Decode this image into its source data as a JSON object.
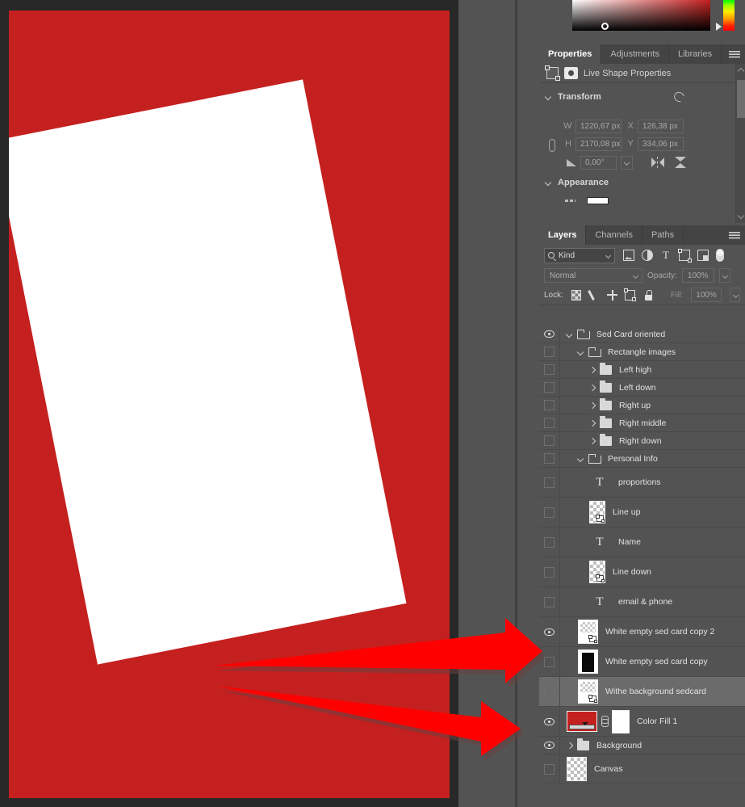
{
  "colors": {
    "canvas_fill": "#c4201f",
    "card": "#ffffff",
    "panel_bg": "#535353",
    "panel_tab_bg": "#444444",
    "selected_row": "#6b6b6b",
    "annotation_arrow": "#ff0000"
  },
  "color_picker": {
    "name": "color-picker-strip",
    "hue_label": "hue-slider",
    "sv_label": "saturation-value-field"
  },
  "properties_panel": {
    "tabs": [
      {
        "label": "Properties",
        "active": true
      },
      {
        "label": "Adjustments",
        "active": false
      },
      {
        "label": "Libraries",
        "active": false
      }
    ],
    "header_label": "Live Shape Properties",
    "sections": {
      "transform": {
        "title": "Transform",
        "fields": [
          {
            "label": "W",
            "value": "1220,67 px"
          },
          {
            "label": "X",
            "value": "126,38 px"
          },
          {
            "label": "H",
            "value": "2170,08 px"
          },
          {
            "label": "Y",
            "value": "334,06 px"
          }
        ],
        "angle": {
          "label": "angle",
          "value": "0,00°"
        }
      },
      "appearance": {
        "title": "Appearance"
      }
    }
  },
  "layers_panel": {
    "tabs": [
      {
        "label": "Layers",
        "active": true
      },
      {
        "label": "Channels",
        "active": false
      },
      {
        "label": "Paths",
        "active": false
      }
    ],
    "filter": {
      "kind_label": "Kind",
      "icons": [
        "image-filter-icon",
        "adjustment-filter-icon",
        "type-filter-icon",
        "shape-filter-icon",
        "smart-object-filter-icon",
        "filter-toggle-icon"
      ]
    },
    "blend": {
      "mode": "Normal",
      "opacity_label": "Opacity:",
      "opacity_value": "100%"
    },
    "lock": {
      "label": "Lock:",
      "fill_label": "Fill:",
      "fill_value": "100%",
      "icons": [
        "lock-transparent-pixels-icon",
        "lock-image-pixels-icon",
        "lock-position-icon",
        "lock-artboard-icon",
        "lock-all-icon"
      ]
    },
    "rows": [
      {
        "name": "Sed Card oriented",
        "type": "group",
        "indent": 0,
        "visible": true,
        "expanded": true,
        "selected": false,
        "thumb": "folder"
      },
      {
        "name": "Rectangle images",
        "type": "group",
        "indent": 1,
        "visible": false,
        "expanded": true,
        "selected": false,
        "thumb": "folder"
      },
      {
        "name": "Left high",
        "type": "group",
        "indent": 2,
        "visible": false,
        "expanded": false,
        "selected": false,
        "thumb": "folder-closed"
      },
      {
        "name": "Left down",
        "type": "group",
        "indent": 2,
        "visible": false,
        "expanded": false,
        "selected": false,
        "thumb": "folder-closed"
      },
      {
        "name": "Right up",
        "type": "group",
        "indent": 2,
        "visible": false,
        "expanded": false,
        "selected": false,
        "thumb": "folder-closed"
      },
      {
        "name": "Right middle",
        "type": "group",
        "indent": 2,
        "visible": false,
        "expanded": false,
        "selected": false,
        "thumb": "folder-closed"
      },
      {
        "name": "Right down",
        "type": "group",
        "indent": 2,
        "visible": false,
        "expanded": false,
        "selected": false,
        "thumb": "folder-closed"
      },
      {
        "name": "Personal Info",
        "type": "group",
        "indent": 1,
        "visible": false,
        "expanded": true,
        "selected": false,
        "thumb": "folder"
      },
      {
        "name": "proportions",
        "type": "text",
        "indent": 2,
        "visible": false,
        "expanded": false,
        "selected": false,
        "thumb": "type"
      },
      {
        "name": "Line up",
        "type": "layer",
        "indent": 2,
        "visible": false,
        "expanded": false,
        "selected": false,
        "thumb": "checker-small"
      },
      {
        "name": "Name",
        "type": "text",
        "indent": 2,
        "visible": false,
        "expanded": false,
        "selected": false,
        "thumb": "type"
      },
      {
        "name": "Line down",
        "type": "layer",
        "indent": 2,
        "visible": false,
        "expanded": false,
        "selected": false,
        "thumb": "checker-small"
      },
      {
        "name": "email & phone",
        "type": "text",
        "indent": 2,
        "visible": false,
        "expanded": false,
        "selected": false,
        "thumb": "type"
      },
      {
        "name": "White empty sed card copy 2",
        "type": "layer",
        "indent": 1,
        "visible": true,
        "expanded": false,
        "selected": false,
        "thumb": "partial-white"
      },
      {
        "name": "White empty sed card copy",
        "type": "layer",
        "indent": 1,
        "visible": false,
        "expanded": false,
        "selected": false,
        "thumb": "white-black"
      },
      {
        "name": "Withe background sedcard",
        "type": "layer",
        "indent": 1,
        "visible": false,
        "expanded": false,
        "selected": true,
        "thumb": "partial-white"
      },
      {
        "name": "Color Fill 1",
        "type": "fill",
        "indent": 0,
        "visible": true,
        "expanded": false,
        "selected": false,
        "thumb": "color-fill"
      },
      {
        "name": "Background",
        "type": "group",
        "indent": 0,
        "visible": true,
        "expanded": false,
        "selected": false,
        "thumb": "folder-closed"
      },
      {
        "name": "Canvas",
        "type": "layer",
        "indent": 0,
        "visible": false,
        "expanded": false,
        "selected": false,
        "thumb": "checker"
      }
    ]
  },
  "annotations": {
    "arrow_1": "arrow-pointing-to-white-empty-sed-card-copy",
    "arrow_2": "arrow-pointing-to-color-fill-1"
  }
}
